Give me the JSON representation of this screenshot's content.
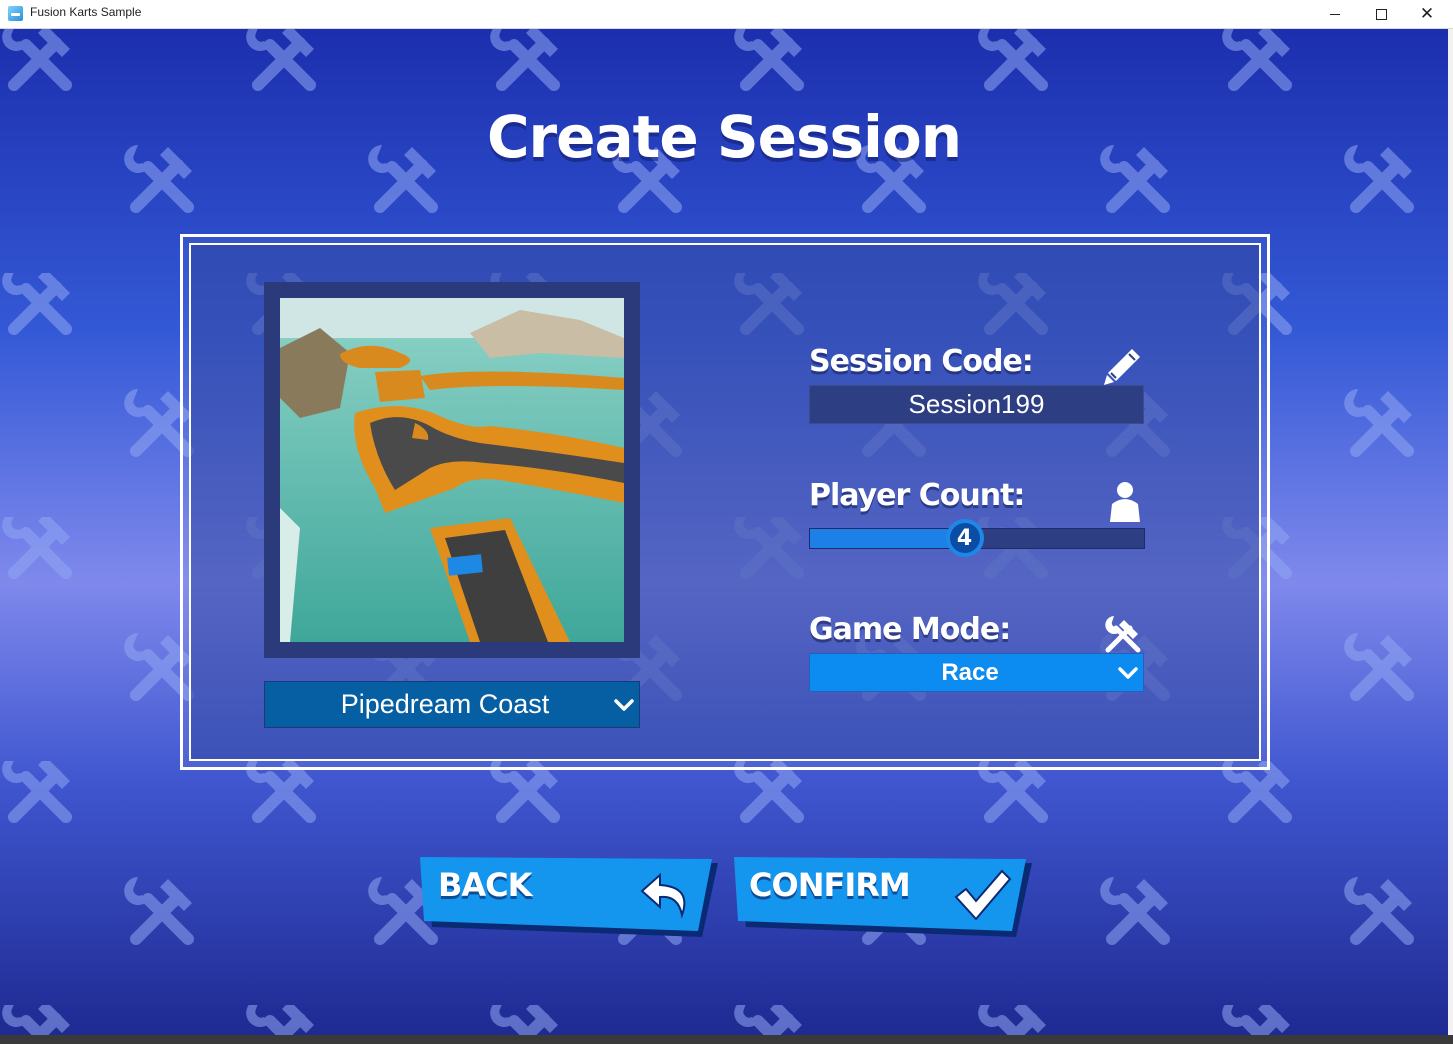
{
  "window": {
    "title": "Fusion Karts Sample",
    "minimize_icon": "minimize-icon",
    "maximize_icon": "maximize-icon",
    "close_icon": "close-icon",
    "close_glyph": "✕"
  },
  "screen": {
    "title": "Create Session",
    "background_icon": "hammer-wrench-icon"
  },
  "track": {
    "preview_icon": "track-preview-image",
    "selected": "Pipedream Coast",
    "dropdown_icon": "chevron-down-icon"
  },
  "session_code": {
    "label": "Session Code:",
    "icon": "pencil-icon",
    "value": "Session199"
  },
  "player_count": {
    "label": "Player Count:",
    "icon": "person-icon",
    "value": "4",
    "fraction": 0.46
  },
  "game_mode": {
    "label": "Game Mode:",
    "icon": "hammer-wrench-icon",
    "selected": "Race",
    "dropdown_icon": "chevron-down-icon"
  },
  "actions": {
    "back_label": "BACK",
    "back_icon": "undo-arrow-icon",
    "confirm_label": "CONFIRM",
    "confirm_icon": "checkmark-icon"
  },
  "colors": {
    "accent_blue": "#0c8bf0",
    "dropdown_dark": "#065ea3",
    "field_bg": "#2d3e83"
  }
}
